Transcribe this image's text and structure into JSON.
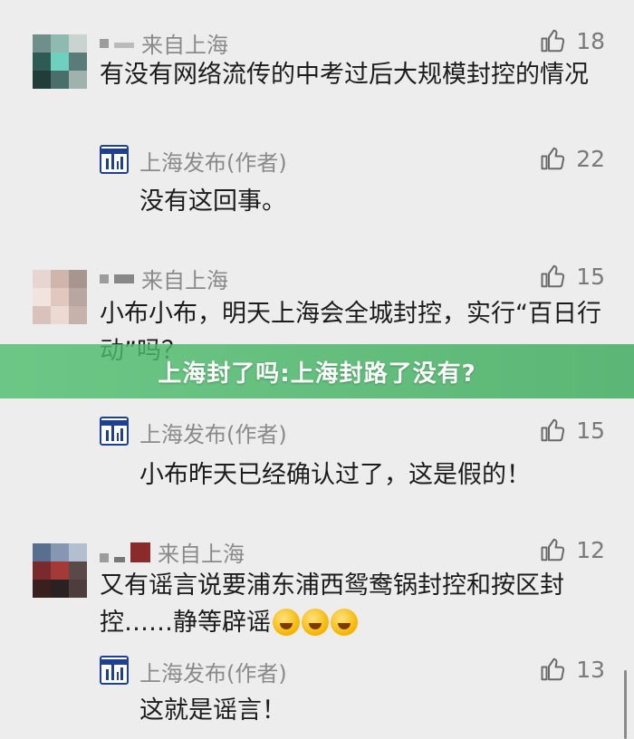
{
  "comments": [
    {
      "source_label": "来自上海",
      "likes": "18",
      "text": "有没有网络流传的中考过后大规模封控的情况",
      "reply": {
        "author": "上海发布(作者)",
        "likes": "22",
        "text": "没有这回事。"
      }
    },
    {
      "source_label": "来自上海",
      "likes": "15",
      "text": "小布小布，明天上海会全城封控，实行“百日行动”吗？",
      "reply": {
        "author": "上海发布(作者)",
        "likes": "15",
        "text": "小布昨天已经确认过了，这是假的！"
      }
    },
    {
      "source_label": "来自上海",
      "likes": "12",
      "text": "又有谣言说要浦东浦西鸳鸯锅封控和按区封控……静等辟谣",
      "reply": {
        "author": "上海发布(作者)",
        "likes": "13",
        "text": "这就是谣言！"
      }
    }
  ],
  "banner": {
    "text": "上海封了吗:上海封路了没有?"
  },
  "icons": {
    "like": "thumbs-up-icon",
    "emoji": "crying-laughing-emoji-icon",
    "logo": "shanghai-fabu-logo-icon"
  },
  "colors": {
    "background": "#ededed",
    "banner": "#4cb86a",
    "muted_text": "#8a8a8a",
    "logo_blue": "#1f3f8f"
  }
}
